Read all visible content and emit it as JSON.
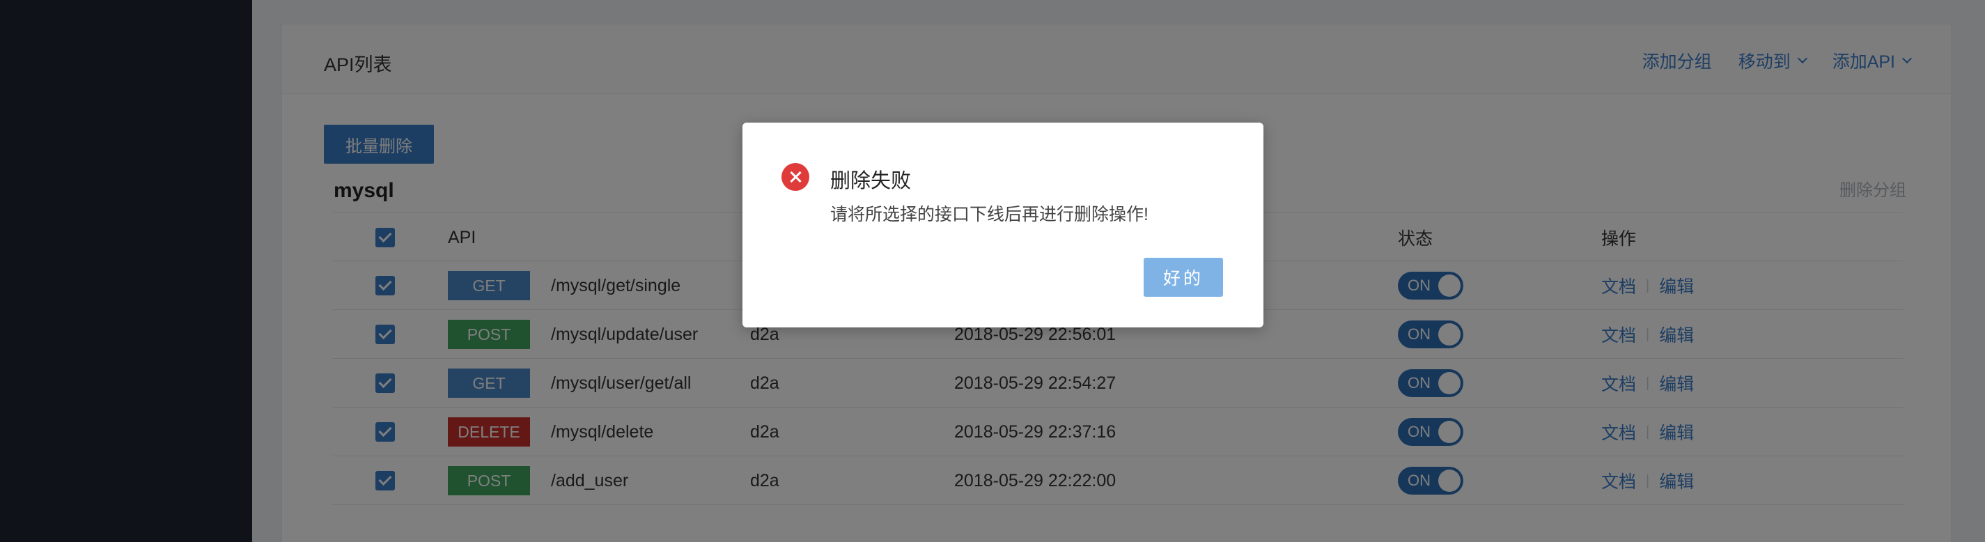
{
  "header": {
    "title": "API列表",
    "actions": [
      "添加分组",
      "移动到",
      "添加API"
    ]
  },
  "toolbar": {
    "batch_delete_label": "批量删除"
  },
  "group": {
    "name": "mysql",
    "delete_label": "删除分组"
  },
  "table": {
    "columns": {
      "api": "API",
      "status": "状态",
      "ops": "操作"
    },
    "rows": [
      {
        "method": "GET",
        "path": "/mysql/get/single",
        "owner": "",
        "time": "",
        "status": "ON",
        "doc": "文档",
        "edit": "编辑"
      },
      {
        "method": "POST",
        "path": "/mysql/update/user",
        "owner": "d2a",
        "time": "2018-05-29 22:56:01",
        "status": "ON",
        "doc": "文档",
        "edit": "编辑"
      },
      {
        "method": "GET",
        "path": "/mysql/user/get/all",
        "owner": "d2a",
        "time": "2018-05-29 22:54:27",
        "status": "ON",
        "doc": "文档",
        "edit": "编辑"
      },
      {
        "method": "DELETE",
        "path": "/mysql/delete",
        "owner": "d2a",
        "time": "2018-05-29 22:37:16",
        "status": "ON",
        "doc": "文档",
        "edit": "编辑"
      },
      {
        "method": "POST",
        "path": "/add_user",
        "owner": "d2a",
        "time": "2018-05-29 22:22:00",
        "status": "ON",
        "doc": "文档",
        "edit": "编辑"
      }
    ]
  },
  "dialog": {
    "title": "删除失败",
    "message": "请将所选择的接口下线后再进行删除操作!",
    "ok_label": "好的",
    "icon": "error-icon"
  },
  "colors": {
    "accent": "#3a7cc7",
    "get": "#4a86c6",
    "post": "#43a460",
    "delete": "#c8312c",
    "error": "#e03b3b"
  }
}
